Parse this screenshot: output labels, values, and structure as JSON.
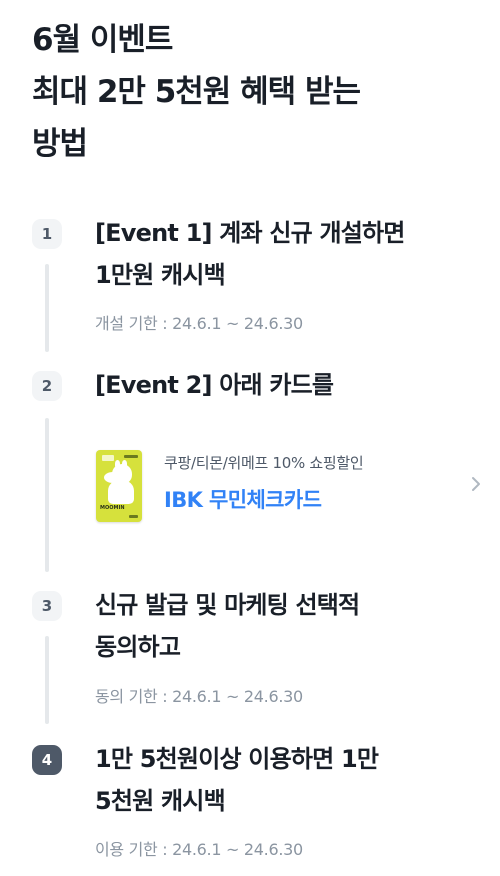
{
  "headline": {
    "line1": "6월 이벤트",
    "line2": "최대 2만 5천원 혜택 받는",
    "line3": "방법"
  },
  "steps": [
    {
      "number": "1",
      "title_line1": "[Event 1] 계좌 신규 개설하면",
      "title_line2": "1만원 캐시백",
      "note": "개설 기한 : 24.6.1 ~ 24.6.30"
    },
    {
      "number": "2",
      "title_line1": "[Event 2] 아래 카드를",
      "card": {
        "subtitle": "쿠팡/티몬/위메프 10% 쇼핑할인",
        "name": "IBK 무민체크카드",
        "image_label": "MOOMIN"
      }
    },
    {
      "number": "3",
      "title_line1": "신규 발급 및 마케팅 선택적",
      "title_line2": "동의하고",
      "note": "동의 기한 : 24.6.1 ~ 24.6.30"
    },
    {
      "number": "4",
      "title_line1": "1만 5천원이상 이용하면 1만",
      "title_line2": "5천원 캐시백",
      "note": "이용 기한 : 24.6.1 ~ 24.6.30"
    }
  ],
  "colors": {
    "accent_blue": "#3182f6",
    "badge_bg": "#f2f4f6",
    "badge_active_bg": "#4e5968",
    "muted_text": "#8b95a1",
    "card_yellow": "#d6e13c"
  }
}
